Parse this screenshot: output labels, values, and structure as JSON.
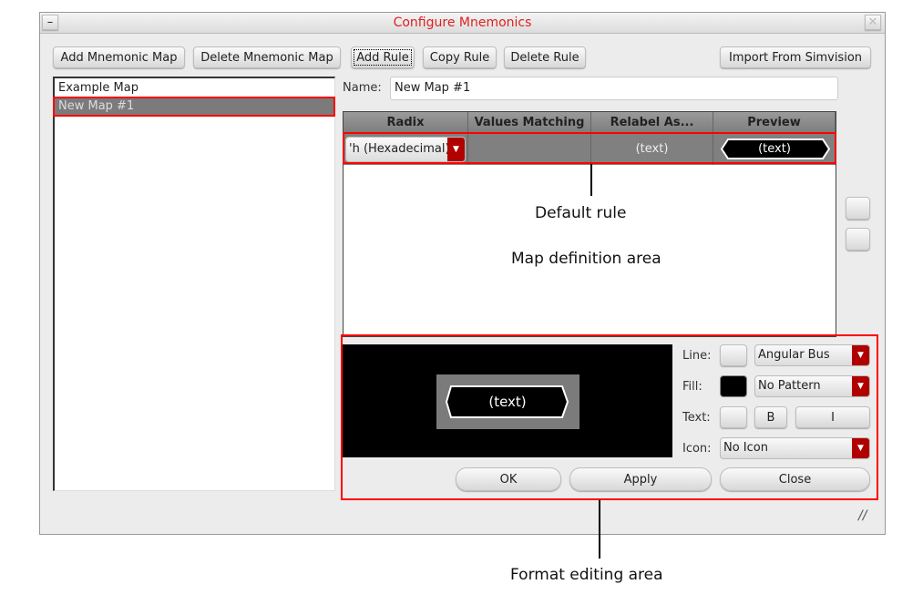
{
  "window": {
    "title": "Configure Mnemonics"
  },
  "toolbar": {
    "add_map": "Add Mnemonic Map",
    "delete_map": "Delete Mnemonic Map",
    "add_rule": "Add Rule",
    "copy_rule": "Copy Rule",
    "delete_rule": "Delete Rule",
    "import": "Import From Simvision"
  },
  "maps": [
    "Example Map",
    "New Map #1"
  ],
  "name": {
    "label": "Name:",
    "value": "New Map #1"
  },
  "table": {
    "headers": [
      "Radix",
      "Values Matching",
      "Relabel As...",
      "Preview"
    ],
    "row": {
      "radix": "'h (Hexadecimal)",
      "values_matching": "",
      "relabel": "(text)",
      "preview": "(text)"
    }
  },
  "format": {
    "preview_text": "(text)",
    "line_label": "Line:",
    "line_value": "Angular Bus",
    "fill_label": "Fill:",
    "fill_value": "No Pattern",
    "text_label": "Text:",
    "bold": "B",
    "italic": "I",
    "icon_label": "Icon:",
    "icon_value": "No Icon"
  },
  "buttons": {
    "ok": "OK",
    "apply": "Apply",
    "close": "Close"
  },
  "annotations": {
    "default_rule": "Default rule",
    "map_area": "Map definition area",
    "format_area": "Format editing area"
  }
}
